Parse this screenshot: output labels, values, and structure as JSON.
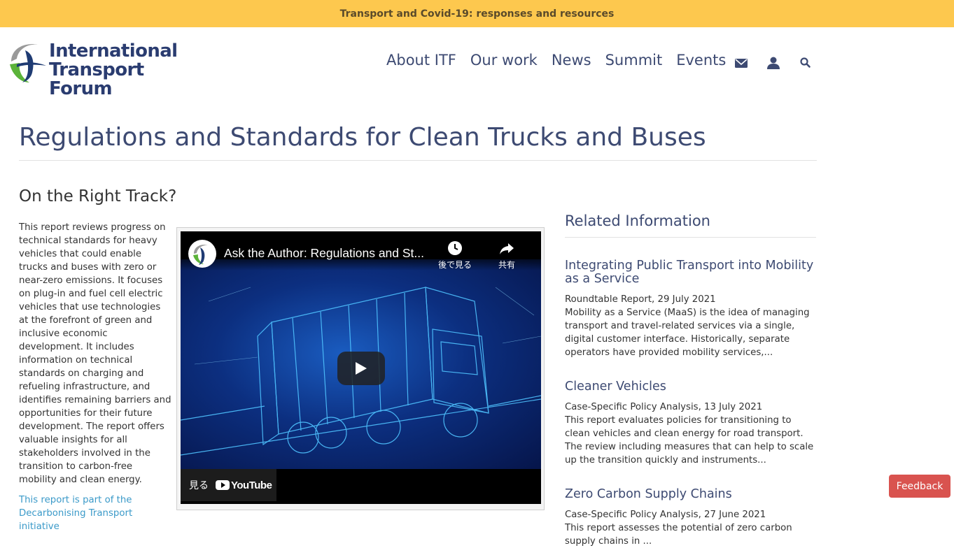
{
  "banner": {
    "text": "Transport and Covid-19: responses and resources"
  },
  "logo": {
    "line1": "International",
    "line2": "Transport Forum"
  },
  "nav": {
    "items": [
      {
        "label": "About ITF"
      },
      {
        "label": "Our work"
      },
      {
        "label": "News"
      },
      {
        "label": "Summit"
      },
      {
        "label": "Events"
      }
    ],
    "icons": [
      "envelope-icon",
      "user-icon",
      "search-icon"
    ]
  },
  "page": {
    "title": "Regulations and Standards for Clean Trucks and Buses",
    "subtitle": "On the Right Track?",
    "body": "This report reviews progress on technical standards for heavy vehicles that could enable trucks and buses with zero or near-zero emissions. It focuses on plug-in and fuel cell electric vehicles that use technologies at the forefront of green and inclusive economic development. It includes information on technical standards on charging and refueling infrastructure, and identifies remaining barriers and opportunities for their future development. The report offers valuable insights for all stakeholders involved in the transition to carbon-free mobility and clean energy.",
    "part_of": "This report is part of the Decarbonising Transport initiative"
  },
  "video": {
    "title": "Ask the Author: Regulations and St...",
    "watch_later": "後で見る",
    "share": "共有",
    "watch_on": "見る",
    "youtube": "YouTube"
  },
  "related": {
    "heading": "Related Information",
    "items": [
      {
        "title": "Integrating Public Transport into Mobility as a Service",
        "meta": "Roundtable Report, 29 July 2021",
        "desc": "Mobility as a Service (MaaS) is the idea of managing transport and travel-related services via a single, digital customer interface. Historically, separate operators have provided mobility services,..."
      },
      {
        "title": "Cleaner Vehicles",
        "meta": "Case-Specific Policy Analysis, 13 July 2021",
        "desc": "This report evaluates policies for transitioning to clean vehicles and clean energy for road transport. The review including measures that can help to scale up the transition quickly and instruments..."
      },
      {
        "title": "Zero Carbon Supply Chains",
        "meta": "Case-Specific Policy Analysis, 27 June 2021",
        "desc": "This report assesses the potential of zero carbon supply chains in ..."
      }
    ]
  },
  "feedback": {
    "label": "Feedback"
  },
  "colors": {
    "banner": "#fdc84e",
    "brand_navy": "#3d4a72",
    "link_blue": "#3b9ac9",
    "feedback_red": "#d9534f"
  }
}
